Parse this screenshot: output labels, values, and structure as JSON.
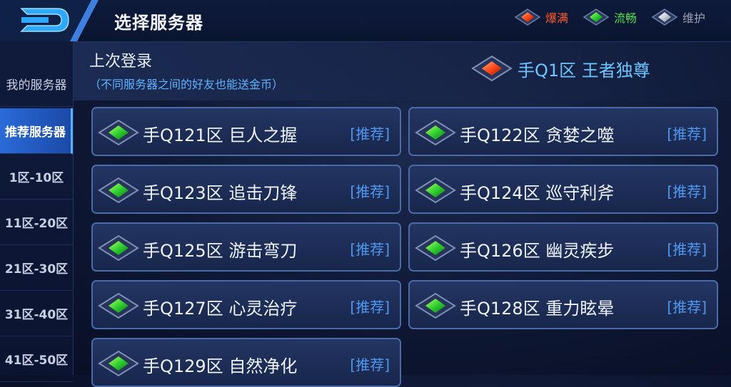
{
  "header": {
    "title": "选择服务器"
  },
  "legend": [
    {
      "label": "爆满",
      "color": "#ff4a2a",
      "icon": "red-diamond-icon"
    },
    {
      "label": "流畅",
      "color": "#45e04a",
      "icon": "green-diamond-icon"
    },
    {
      "label": "维护",
      "color": "#9aa3b5",
      "icon": "gray-diamond-icon"
    }
  ],
  "sidebar": {
    "items": [
      {
        "label": "我的服务器"
      },
      {
        "label": "推荐服务器",
        "active": true
      },
      {
        "label": "1区-10区"
      },
      {
        "label": "11区-20区"
      },
      {
        "label": "21区-30区"
      },
      {
        "label": "31区-40区"
      },
      {
        "label": "41区-50区"
      }
    ]
  },
  "last_login": {
    "title": "上次登录",
    "note": "（不同服务器之间的好友也能送金币）",
    "server": "手Q1区 王者独尊",
    "status_icon": "red-diamond-icon"
  },
  "servers": [
    {
      "name": "手Q121区 巨人之握",
      "tag": "[推荐]",
      "status_icon": "green-diamond-icon"
    },
    {
      "name": "手Q122区 贪婪之噬",
      "tag": "[推荐]",
      "status_icon": "green-diamond-icon"
    },
    {
      "name": "手Q123区 追击刀锋",
      "tag": "[推荐]",
      "status_icon": "green-diamond-icon"
    },
    {
      "name": "手Q124区 巡守利斧",
      "tag": "[推荐]",
      "status_icon": "green-diamond-icon"
    },
    {
      "name": "手Q125区 游击弯刀",
      "tag": "[推荐]",
      "status_icon": "green-diamond-icon"
    },
    {
      "name": "手Q126区 幽灵疾步",
      "tag": "[推荐]",
      "status_icon": "green-diamond-icon"
    },
    {
      "name": "手Q127区 心灵治疗",
      "tag": "[推荐]",
      "status_icon": "green-diamond-icon"
    },
    {
      "name": "手Q128区 重力眩晕",
      "tag": "[推荐]",
      "status_icon": "green-diamond-icon"
    },
    {
      "name": "手Q129区 自然净化",
      "tag": "[推荐]",
      "status_icon": "green-diamond-icon"
    }
  ]
}
